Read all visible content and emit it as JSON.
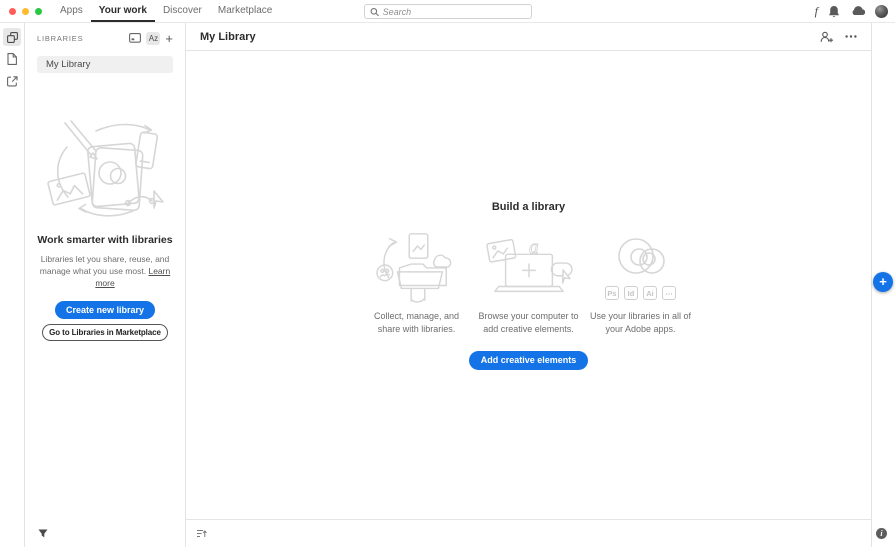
{
  "colors": {
    "accent_blue": "#1473e6",
    "traffic_red": "#ff5f57",
    "traffic_yellow": "#febc2e",
    "traffic_green": "#28c840",
    "selected_item_bg": "#f0f0f0",
    "border": "#e3e3e3",
    "text_dark": "#2c2c2c",
    "text_gray": "#6e6e6e",
    "illustration_stroke": "#d6d6d6"
  },
  "topbar": {
    "nav": [
      {
        "label": "Apps",
        "active": false
      },
      {
        "label": "Your work",
        "active": true
      },
      {
        "label": "Discover",
        "active": false
      },
      {
        "label": "Marketplace",
        "active": false
      }
    ],
    "search": {
      "placeholder": "Search"
    },
    "functions_glyph": "f"
  },
  "left_rail": {
    "items": [
      {
        "name": "libraries",
        "selected": true
      },
      {
        "name": "files",
        "selected": false
      },
      {
        "name": "shared-with-you",
        "selected": false
      }
    ]
  },
  "sidebar": {
    "header_label": "LIBRARIES",
    "sort_toggle_label": "Az",
    "add_library_glyph": "+",
    "libraries": [
      {
        "label": "My Library",
        "selected": true
      }
    ],
    "empty_state": {
      "title": "Work smarter with libraries",
      "description": "Libraries let you share, reuse, and manage what you use most.",
      "learn_more_label": "Learn more",
      "create_button_label": "Create new library",
      "marketplace_button_label": "Go to Libraries in Marketplace"
    }
  },
  "main": {
    "title": "My Library",
    "empty_state": {
      "title": "Build a library",
      "cards": [
        {
          "caption": "Collect, manage, and share with libraries."
        },
        {
          "caption": "Browse your computer to add creative elements."
        },
        {
          "caption": "Use your libraries in all of your Adobe apps."
        }
      ],
      "app_badges": [
        "Ps",
        "Id",
        "Ai",
        "⋯"
      ],
      "add_button_label": "Add creative elements"
    },
    "fab_glyph": "+",
    "info_glyph": "i"
  }
}
